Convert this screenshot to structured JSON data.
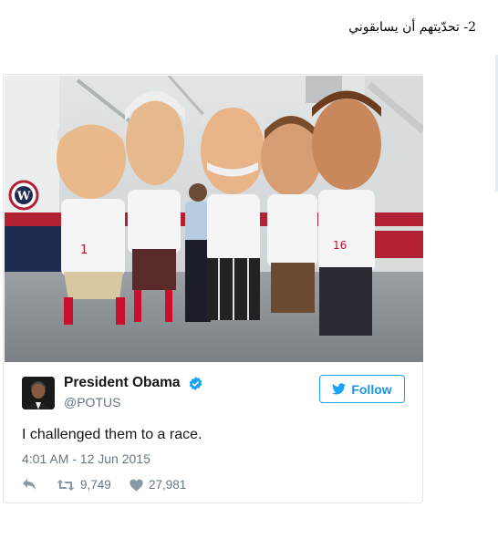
{
  "heading": "2- تحدّيتهم أن يسابقوني",
  "tweet": {
    "name": "President Obama",
    "handle": "@POTUS",
    "follow_label": "Follow",
    "text": "I challenged them to a race.",
    "timestamp": "4:01 AM - 12 Jun 2015",
    "retweets": "9,749",
    "likes": "27,981",
    "photo_text": {
      "jersey_numbers": [
        "1",
        "16"
      ],
      "team_logo_letter": "W"
    }
  },
  "colors": {
    "twitter_blue": "#1da1f2",
    "text_primary": "#14171a",
    "text_secondary": "#657786",
    "nationals_red": "#c8102e"
  },
  "icons": [
    "verified-badge-icon",
    "twitter-bird-icon",
    "reply-icon",
    "retweet-icon",
    "heart-icon"
  ]
}
